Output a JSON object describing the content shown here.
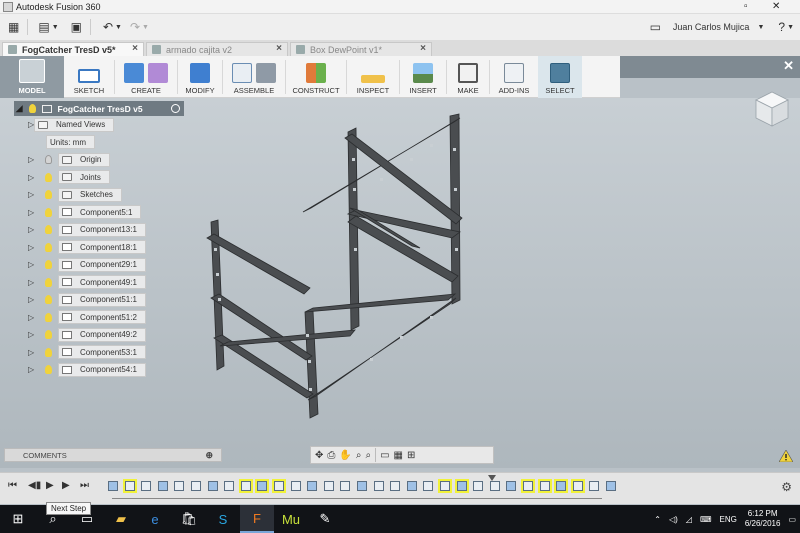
{
  "window": {
    "title": "Autodesk Fusion 360"
  },
  "quickbar": {
    "user_name": "Juan Carlos Mujica"
  },
  "tabs": [
    {
      "label": "FogCatcher TresD v5*",
      "active": true
    },
    {
      "label": "armado cajita v2",
      "active": false
    },
    {
      "label": "Box DewPoint v1*",
      "active": false
    }
  ],
  "toolbar": {
    "groups": [
      {
        "label": "MODEL"
      },
      {
        "label": "SKETCH"
      },
      {
        "label": "CREATE"
      },
      {
        "label": "MODIFY"
      },
      {
        "label": "ASSEMBLE"
      },
      {
        "label": "CONSTRUCT"
      },
      {
        "label": "INSPECT"
      },
      {
        "label": "INSERT"
      },
      {
        "label": "MAKE"
      },
      {
        "label": "ADD-INS"
      },
      {
        "label": "SELECT"
      }
    ]
  },
  "browser": {
    "root": "FogCatcher TresD v5",
    "items": [
      {
        "label": "Named Views",
        "type": "folder",
        "bulb": "none"
      },
      {
        "label": "Units: mm",
        "type": "units",
        "bulb": "none"
      },
      {
        "label": "Origin",
        "type": "folder",
        "bulb": "off"
      },
      {
        "label": "Joints",
        "type": "folder",
        "bulb": "on"
      },
      {
        "label": "Sketches",
        "type": "folder",
        "bulb": "on"
      },
      {
        "label": "Component5:1",
        "type": "component",
        "bulb": "on"
      },
      {
        "label": "Component13:1",
        "type": "component",
        "bulb": "on"
      },
      {
        "label": "Component18:1",
        "type": "component",
        "bulb": "on"
      },
      {
        "label": "Component29:1",
        "type": "component",
        "bulb": "on"
      },
      {
        "label": "Component49:1",
        "type": "component",
        "bulb": "on"
      },
      {
        "label": "Component51:1",
        "type": "component",
        "bulb": "on"
      },
      {
        "label": "Component51:2",
        "type": "component",
        "bulb": "on"
      },
      {
        "label": "Component49:2",
        "type": "component",
        "bulb": "on"
      },
      {
        "label": "Component53:1",
        "type": "component",
        "bulb": "on"
      },
      {
        "label": "Component54:1",
        "type": "component",
        "bulb": "on"
      }
    ]
  },
  "comments": {
    "label": "COMMENTS"
  },
  "taskbar": {
    "tooltip": "Next Step",
    "lang": "ENG",
    "time": "6:12 PM",
    "date": "6/26/2016"
  },
  "colors": {
    "accent": "#8f9aa2",
    "highlight": "#f1f23a",
    "frame": "#4a4d50"
  }
}
